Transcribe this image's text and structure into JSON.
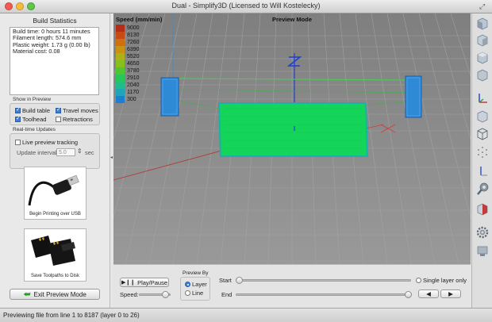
{
  "window": {
    "title": "Dual - Simplify3D (Licensed to Will Kostelecky)"
  },
  "build_statistics": {
    "title": "Build Statistics",
    "lines": [
      "Build time: 0 hours 11 minutes",
      "Filament length: 574.6 mm",
      "Plastic weight: 1.73 g (0.00 lb)",
      "Material cost: 0.08"
    ]
  },
  "show_in_preview": {
    "label": "Show in Preview",
    "options": [
      {
        "label": "Build table",
        "checked": true
      },
      {
        "label": "Travel moves",
        "checked": true
      },
      {
        "label": "Toolhead",
        "checked": true
      },
      {
        "label": "Retractions",
        "checked": false
      }
    ]
  },
  "realtime_updates": {
    "label": "Real-time Updates",
    "live_tracking_label": "Live preview tracking",
    "live_tracking_checked": false,
    "interval_label": "Update interval",
    "interval_value": "5.0",
    "interval_unit": "sec"
  },
  "actions": {
    "print_usb_label": "Begin Printing over USB",
    "save_disk_label": "Save Toolpaths to Disk",
    "exit_label": "Exit Preview Mode"
  },
  "viewport": {
    "legend_title": "Speed (mm/min)",
    "mode_title": "Preview Mode",
    "axis_label": "Z",
    "legend": [
      {
        "value": "9000",
        "color": "#b52d18"
      },
      {
        "value": "8130",
        "color": "#c84b16"
      },
      {
        "value": "7260",
        "color": "#cf6f10"
      },
      {
        "value": "6390",
        "color": "#c99312"
      },
      {
        "value": "5520",
        "color": "#aeb018"
      },
      {
        "value": "4650",
        "color": "#86bf1e"
      },
      {
        "value": "3780",
        "color": "#4fc531"
      },
      {
        "value": "2910",
        "color": "#26c75a"
      },
      {
        "value": "2040",
        "color": "#1fbd8b"
      },
      {
        "value": "1170",
        "color": "#1ea6b8"
      },
      {
        "value": "300",
        "color": "#1d7fd3"
      }
    ]
  },
  "controls": {
    "play_pause_label": "Play/Pause",
    "speed_label": "Speed:",
    "preview_by_label": "Preview By",
    "preview_by_options": [
      {
        "label": "Layer",
        "selected": true
      },
      {
        "label": "Line",
        "selected": false
      }
    ],
    "start_label": "Start",
    "end_label": "End",
    "single_layer_label": "Single layer only"
  },
  "toolbar_icons": [
    "cube-icon",
    "cube-icon",
    "cube-icon",
    "cube-icon",
    "axes-icon",
    "cube-icon",
    "wireframe-cube-icon",
    "points-icon",
    "move-axis-icon",
    "wrench-icon",
    "section-cut-icon",
    "gear-icon",
    "toolhead-icon"
  ],
  "status": {
    "text": "Previewing file from line 1 to 8187 (layer 0 to 26)"
  }
}
